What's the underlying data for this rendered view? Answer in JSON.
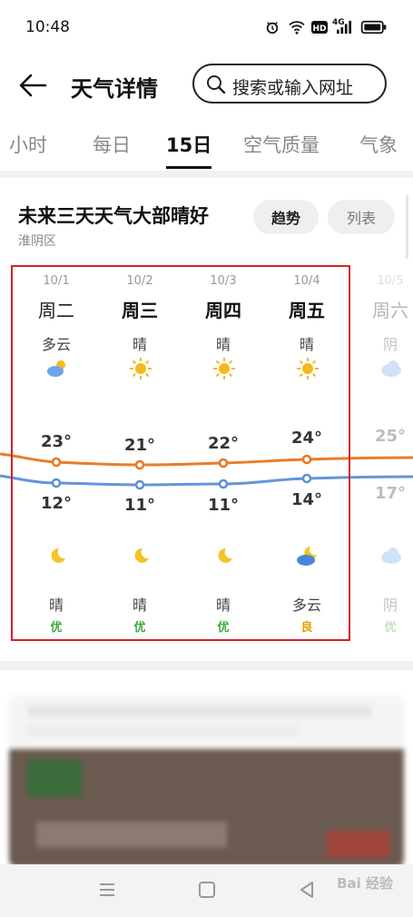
{
  "status_bar": {
    "time": "10:48",
    "network": "4G"
  },
  "header": {
    "back_icon": "arrow-left-icon",
    "title": "天气详情",
    "search_placeholder": "搜索或输入网址"
  },
  "tabs": [
    {
      "label": "小时"
    },
    {
      "label": "每日"
    },
    {
      "label": "15日",
      "active": true
    },
    {
      "label": "空气质量"
    },
    {
      "label": "气象"
    }
  ],
  "summary": {
    "title": "未来三天天气大部晴好",
    "location": "淮阴区",
    "trend_label": "趋势",
    "list_label": "列表"
  },
  "forecast": [
    {
      "date": "10/1",
      "weekday": "周二",
      "day_cond": "多云",
      "day_icon": "cloudy-sun-icon",
      "high": "23°",
      "low": "12°",
      "night_icon": "moon-icon",
      "night_cond": "晴",
      "aqi": "优",
      "aqi_color": "#3cab3c"
    },
    {
      "date": "10/2",
      "weekday": "周三",
      "day_cond": "晴",
      "day_icon": "sun-icon",
      "high": "21°",
      "low": "11°",
      "night_icon": "moon-icon",
      "night_cond": "晴",
      "aqi": "优",
      "aqi_color": "#3cab3c"
    },
    {
      "date": "10/3",
      "weekday": "周四",
      "day_cond": "晴",
      "day_icon": "sun-icon",
      "high": "22°",
      "low": "11°",
      "night_icon": "moon-icon",
      "night_cond": "晴",
      "aqi": "优",
      "aqi_color": "#3cab3c"
    },
    {
      "date": "10/4",
      "weekday": "周五",
      "day_cond": "晴",
      "day_icon": "sun-icon",
      "high": "24°",
      "low": "14°",
      "night_icon": "cloudy-moon-icon",
      "night_cond": "多云",
      "aqi": "良",
      "aqi_color": "#e0a100"
    },
    {
      "date": "10/5",
      "weekday": "周六",
      "day_cond": "阴",
      "day_icon": "cloud-icon",
      "high": "25°",
      "low": "17°",
      "night_icon": "cloud-icon",
      "night_cond": "阴",
      "aqi": "优",
      "aqi_color": "#3cab3c"
    }
  ],
  "colors": {
    "high_line": "#e8761e",
    "low_line": "#5b8fd6",
    "highlight": "#d7202a"
  },
  "watermark": "Bai 经验"
}
